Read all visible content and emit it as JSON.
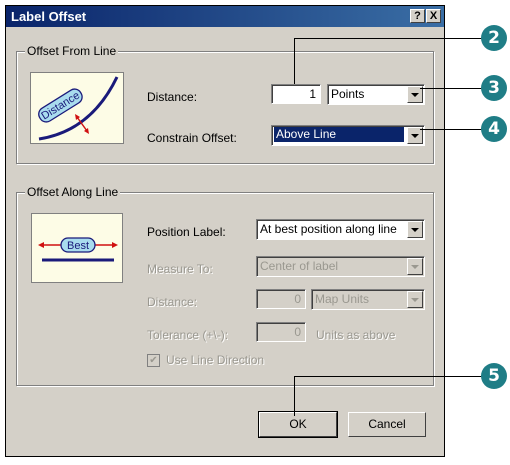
{
  "dialog": {
    "title": "Label Offset",
    "help_button": "?",
    "close_button": "X"
  },
  "offset_from_line": {
    "group_label": "Offset From Line",
    "picture_text": "Distance",
    "distance_label": "Distance:",
    "distance_value": "1",
    "distance_units": "Points",
    "constrain_label": "Constrain Offset:",
    "constrain_value": "Above Line"
  },
  "offset_along_line": {
    "group_label": "Offset Along Line",
    "picture_text": "Best",
    "position_label": "Position Label:",
    "position_value": "At best position along line",
    "measure_to_label": "Measure To:",
    "measure_to_value": "Center of label",
    "distance_label": "Distance:",
    "distance_value": "0",
    "distance_units": "Map Units",
    "tolerance_label": "Tolerance (+\\-):",
    "tolerance_value": "0",
    "tolerance_units": "Units as above",
    "use_line_direction_label": "Use Line Direction",
    "use_line_direction_checked": true
  },
  "buttons": {
    "ok": "OK",
    "cancel": "Cancel"
  },
  "callouts": [
    "2",
    "3",
    "4",
    "5"
  ],
  "colors": {
    "title_bar": "#0a246a",
    "callout": "#1f7d86",
    "dialog_face": "#d4d0c8"
  }
}
